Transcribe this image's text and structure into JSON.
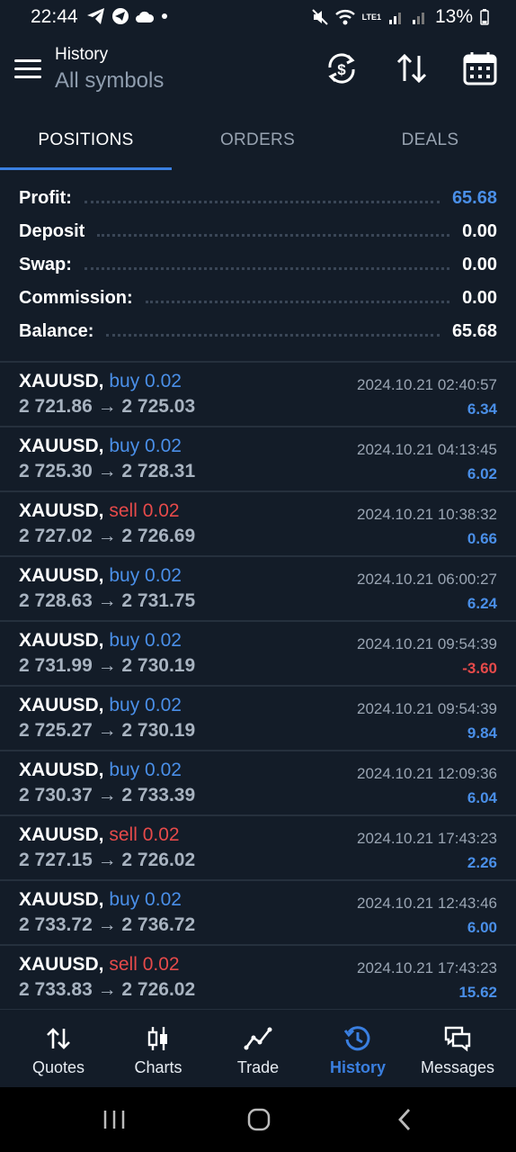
{
  "status": {
    "time": "22:44",
    "battery": "13%",
    "network": "LTE1"
  },
  "header": {
    "title": "History",
    "subtitle": "All symbols"
  },
  "tabs": [
    {
      "label": "POSITIONS"
    },
    {
      "label": "ORDERS"
    },
    {
      "label": "DEALS"
    }
  ],
  "summary": {
    "profit_label": "Profit:",
    "profit": "65.68",
    "deposit_label": "Deposit",
    "deposit": "0.00",
    "swap_label": "Swap:",
    "swap": "0.00",
    "commission_label": "Commission:",
    "commission": "0.00",
    "balance_label": "Balance:",
    "balance": "65.68"
  },
  "deals": [
    {
      "symbol": "XAUUSD,",
      "side": "buy 0.02",
      "prices": "2 721.86 → 2 725.03",
      "time": "2024.10.21 02:40:57",
      "profit": "6.34"
    },
    {
      "symbol": "XAUUSD,",
      "side": "buy 0.02",
      "prices": "2 725.30 → 2 728.31",
      "time": "2024.10.21 04:13:45",
      "profit": "6.02"
    },
    {
      "symbol": "XAUUSD,",
      "side": "sell 0.02",
      "prices": "2 727.02 → 2 726.69",
      "time": "2024.10.21 10:38:32",
      "profit": "0.66"
    },
    {
      "symbol": "XAUUSD,",
      "side": "buy 0.02",
      "prices": "2 728.63 → 2 731.75",
      "time": "2024.10.21 06:00:27",
      "profit": "6.24"
    },
    {
      "symbol": "XAUUSD,",
      "side": "buy 0.02",
      "prices": "2 731.99 → 2 730.19",
      "time": "2024.10.21 09:54:39",
      "profit": "-3.60"
    },
    {
      "symbol": "XAUUSD,",
      "side": "buy 0.02",
      "prices": "2 725.27 → 2 730.19",
      "time": "2024.10.21 09:54:39",
      "profit": "9.84"
    },
    {
      "symbol": "XAUUSD,",
      "side": "buy 0.02",
      "prices": "2 730.37 → 2 733.39",
      "time": "2024.10.21 12:09:36",
      "profit": "6.04"
    },
    {
      "symbol": "XAUUSD,",
      "side": "sell 0.02",
      "prices": "2 727.15 → 2 726.02",
      "time": "2024.10.21 17:43:23",
      "profit": "2.26"
    },
    {
      "symbol": "XAUUSD,",
      "side": "buy 0.02",
      "prices": "2 733.72 → 2 736.72",
      "time": "2024.10.21 12:43:46",
      "profit": "6.00"
    },
    {
      "symbol": "XAUUSD,",
      "side": "sell 0.02",
      "prices": "2 733.83 → 2 726.02",
      "time": "2024.10.21 17:43:23",
      "profit": "15.62"
    }
  ],
  "nav": [
    {
      "label": "Quotes",
      "icon": "quotes-icon"
    },
    {
      "label": "Charts",
      "icon": "charts-icon"
    },
    {
      "label": "Trade",
      "icon": "trade-icon"
    },
    {
      "label": "History",
      "icon": "history-icon"
    },
    {
      "label": "Messages",
      "icon": "messages-icon"
    }
  ],
  "colors": {
    "background": "#131c28",
    "accent": "#3a7fe0",
    "buy": "#4a8fe8",
    "sell": "#e64a4a",
    "profit_positive": "#4a8fe8",
    "profit_negative": "#e64a4a"
  }
}
